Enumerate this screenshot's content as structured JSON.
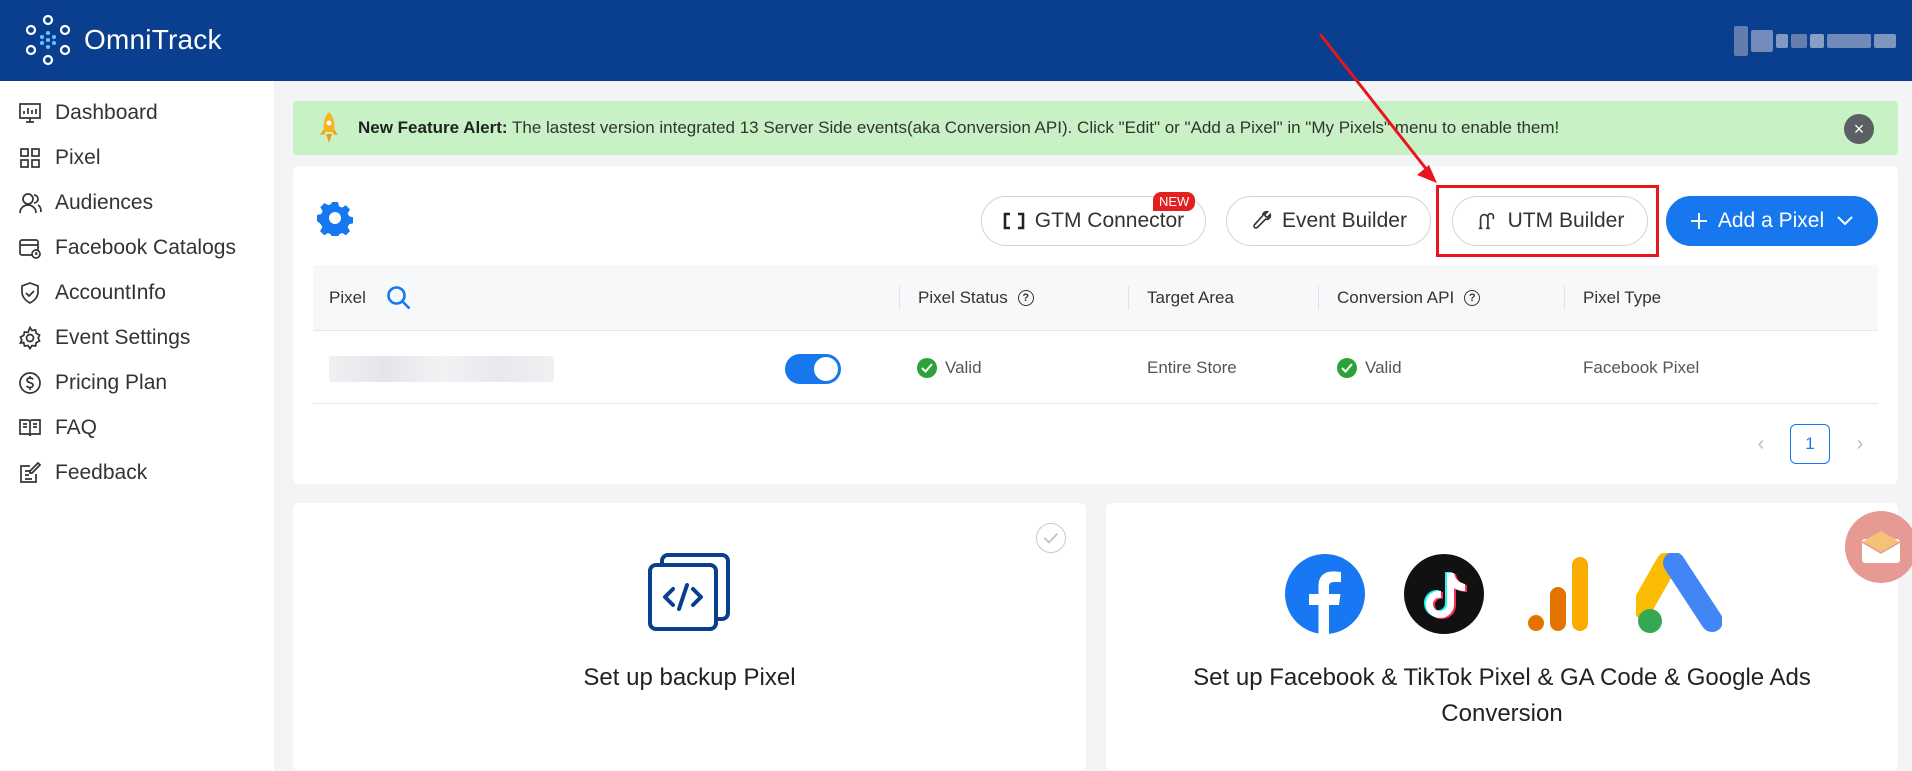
{
  "app": {
    "name": "OmniTrack"
  },
  "sidebar": {
    "items": [
      {
        "label": "Dashboard",
        "icon": "dashboard-icon"
      },
      {
        "label": "Pixel",
        "icon": "grid-icon"
      },
      {
        "label": "Audiences",
        "icon": "users-icon"
      },
      {
        "label": "Facebook Catalogs",
        "icon": "catalog-icon"
      },
      {
        "label": "AccountInfo",
        "icon": "shield-icon"
      },
      {
        "label": "Event Settings",
        "icon": "gear-icon"
      },
      {
        "label": "Pricing Plan",
        "icon": "dollar-icon"
      },
      {
        "label": "FAQ",
        "icon": "book-icon"
      },
      {
        "label": "Feedback",
        "icon": "edit-icon"
      }
    ]
  },
  "alert": {
    "title": "New Feature Alert:",
    "message": " The lastest version integrated 13 Server Side events(aka Conversion API). Click \"Edit\" or \"Add a Pixel\" in \"My Pixels\" menu to enable them!",
    "close": "×"
  },
  "toolbar": {
    "gtm_label": "GTM Connector",
    "gtm_badge": "NEW",
    "event_label": "Event Builder",
    "utm_label": "UTM Builder",
    "add_label": "Add a Pixel"
  },
  "table": {
    "headers": {
      "pixel": "Pixel",
      "status": "Pixel Status",
      "target": "Target Area",
      "capi": "Conversion API",
      "type": "Pixel Type"
    },
    "rows": [
      {
        "enabled": true,
        "status": "Valid",
        "target": "Entire Store",
        "capi": "Valid",
        "type": "Facebook Pixel"
      }
    ]
  },
  "pagination": {
    "current": "1",
    "prev": "‹",
    "next": "›"
  },
  "cards": {
    "backup": {
      "title": "Set up backup Pixel"
    },
    "setup": {
      "title_line1": "Set up Facebook & TikTok Pixel & GA Code & Google Ads",
      "title_line2": "Conversion"
    }
  },
  "colors": {
    "topbar": "#0a3e8f",
    "primary": "#1677ee",
    "alert_bg": "#c9f1c6",
    "valid": "#2ba33a",
    "highlight": "#e8141e"
  }
}
